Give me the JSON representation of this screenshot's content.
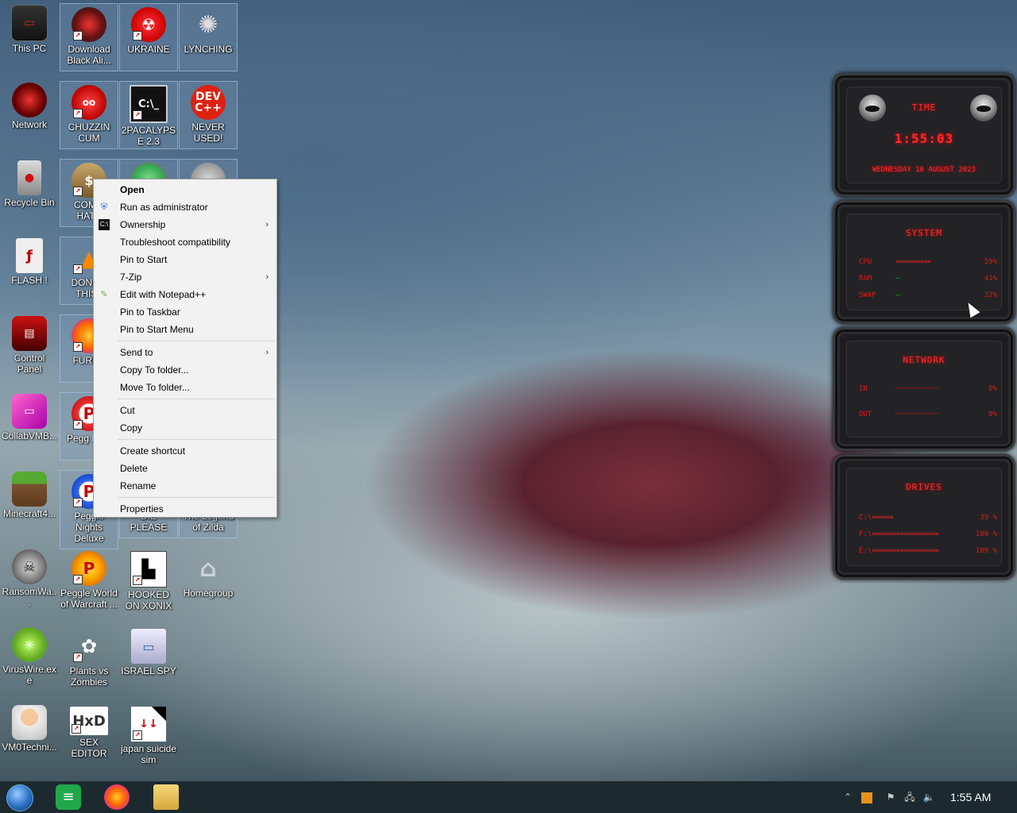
{
  "desktop_icons": [
    {
      "label": "This PC",
      "icon": "monitor-icon"
    },
    {
      "label": "Download Black Ali...",
      "icon": "alien-icon"
    },
    {
      "label": "UKRAINE",
      "icon": "radiation-icon"
    },
    {
      "label": "LYNCHING",
      "icon": "flag-icon"
    },
    {
      "label": "Network",
      "icon": "network-icon"
    },
    {
      "label": "CHUZZIN CUM",
      "icon": "chuzzle-icon"
    },
    {
      "label": "2PACALYPSE 2.3",
      "icon": "console-icon"
    },
    {
      "label": "NEVER USED!",
      "icon": "dev-cpp-icon"
    },
    {
      "label": "Recycle Bin",
      "icon": "recycle-bin-icon"
    },
    {
      "label": "COMM HATE",
      "icon": "money-bag-icon"
    },
    {
      "label": "FLASH !",
      "icon": "flash-icon"
    },
    {
      "label": "DONT S THIS I",
      "icon": "vlc-icon"
    },
    {
      "label": "Control Panel",
      "icon": "control-panel-icon"
    },
    {
      "label": "FURRY",
      "icon": "firefox-icon"
    },
    {
      "label": "CollabVMB...",
      "icon": "collabvm-icon"
    },
    {
      "label": "Pegg Delu",
      "icon": "peggle-icon"
    },
    {
      "label": "Minecraft4...",
      "icon": "minecraft-icon"
    },
    {
      "label": "Peggle Nights Deluxe",
      "icon": "peggle-icon"
    },
    {
      "label": "DIE PLEASE",
      "icon": "program-icon"
    },
    {
      "label": "The Legend of Zilda",
      "icon": "program-icon"
    },
    {
      "label": "RansomWa...",
      "icon": "skull-icon"
    },
    {
      "label": "Peggle World of Warcraft ...",
      "icon": "peggle-icon"
    },
    {
      "label": "HOOKED ON XONIX",
      "icon": "xonix-icon"
    },
    {
      "label": "Homegroup",
      "icon": "homegroup-icon"
    },
    {
      "label": "VirusWire.exe",
      "icon": "lime-icon"
    },
    {
      "label": "Plants vs Zombies",
      "icon": "plant-icon"
    },
    {
      "label": "ISRAEL SPY",
      "icon": "spy-computer-icon"
    },
    {
      "label": "VM0Techni...",
      "icon": "doctor-icon"
    },
    {
      "label": "SEX EDITOR",
      "icon": "hxd-icon"
    },
    {
      "label": "japan suicide sim",
      "icon": "program-icon"
    }
  ],
  "context_menu": {
    "items": [
      {
        "label": "Open",
        "bold": true
      },
      {
        "label": "Run as administrator",
        "icon": "shield-icon"
      },
      {
        "label": "Ownership",
        "submenu": true,
        "icon": "cmd-icon"
      },
      {
        "label": "Troubleshoot compatibility"
      },
      {
        "label": "Pin to Start"
      },
      {
        "label": "7-Zip",
        "submenu": true
      },
      {
        "label": "Edit with Notepad++",
        "icon": "notepad-icon"
      },
      {
        "label": "Pin to Taskbar"
      },
      {
        "label": "Pin to Start Menu"
      },
      {
        "separator": true
      },
      {
        "label": "Send to",
        "submenu": true
      },
      {
        "label": "Copy To folder..."
      },
      {
        "label": "Move To folder..."
      },
      {
        "separator": true
      },
      {
        "label": "Cut"
      },
      {
        "label": "Copy"
      },
      {
        "separator": true
      },
      {
        "label": "Create shortcut"
      },
      {
        "label": "Delete"
      },
      {
        "label": "Rename"
      },
      {
        "separator": true
      },
      {
        "label": "Properties"
      }
    ]
  },
  "widget": {
    "time": {
      "title": "TIME",
      "clock": "1:55:03",
      "date": "WEDNESDAY 16 AUGUST 2023"
    },
    "system": {
      "title": "SYSTEM",
      "rows": [
        {
          "key": "CPU",
          "value": "59%",
          "level": 0.59
        },
        {
          "key": "RAM",
          "value": "41%",
          "level": 0.41
        },
        {
          "key": "SWAP",
          "value": "22%",
          "level": 0.22
        }
      ]
    },
    "network": {
      "title": "NETWORK",
      "rows": [
        {
          "key": "IN",
          "value": "0%"
        },
        {
          "key": "OUT",
          "value": "0%"
        }
      ]
    },
    "drives": {
      "title": "DRIVES",
      "rows": [
        {
          "key": "C:\\",
          "value": "39 %",
          "level": 0.39
        },
        {
          "key": "F:\\",
          "value": "100 %",
          "level": 1.0
        },
        {
          "key": "E:\\",
          "value": "100 %",
          "level": 1.0
        }
      ]
    }
  },
  "taskbar": {
    "pinned": [
      "start-orb-icon",
      "notes-icon",
      "firefox-icon",
      "file-explorer-icon"
    ],
    "tray_icons": [
      "chevron-up-icon",
      "app-tray-icon",
      "action-center-flag-icon",
      "network-tray-icon",
      "volume-icon"
    ],
    "clock": "1:55 AM"
  },
  "colors": {
    "accent_red": "#ff2a2a",
    "menu_bg": "#f2f2f2",
    "taskbar_bg": "#1c2a30"
  }
}
